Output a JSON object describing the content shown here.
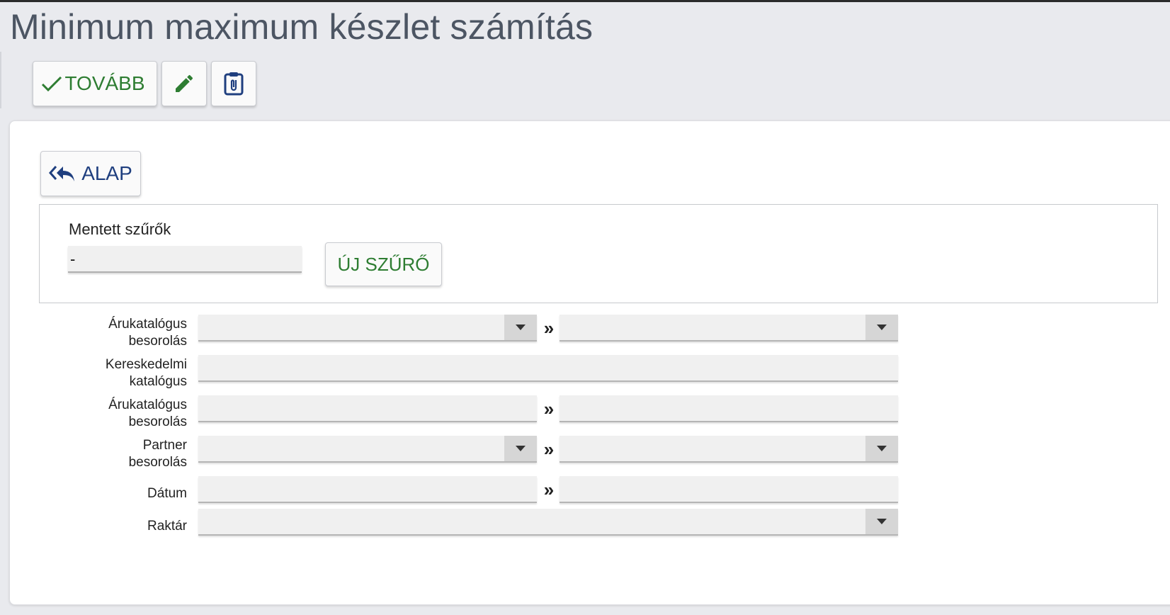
{
  "header": {
    "title": "Minimum maximum készlet számítás"
  },
  "toolbar": {
    "next_label": "TOVÁBB",
    "edit_icon": "pencil-icon",
    "attach_icon": "clipboard-attach-icon"
  },
  "panel": {
    "basic_label": "ALAP",
    "saved_filters": {
      "label": "Mentett szűrők",
      "value": "-",
      "new_filter_label": "ÚJ SZŰRŐ"
    },
    "range_separator": "»",
    "fields": [
      {
        "label_line1": "Árukatalógus",
        "label_line2": "besorolás"
      },
      {
        "label_line1": "Kereskedelmi",
        "label_line2": "katalógus"
      },
      {
        "label_line1": "Árukatalógus",
        "label_line2": "besorolás"
      },
      {
        "label_line1": "Partner",
        "label_line2": "besorolás"
      },
      {
        "label_line1": "Dátum"
      },
      {
        "label_line1": "Raktár"
      }
    ]
  },
  "colors": {
    "green": "#2e7d32",
    "blue": "#1f3f7f",
    "title": "#4c5563"
  }
}
